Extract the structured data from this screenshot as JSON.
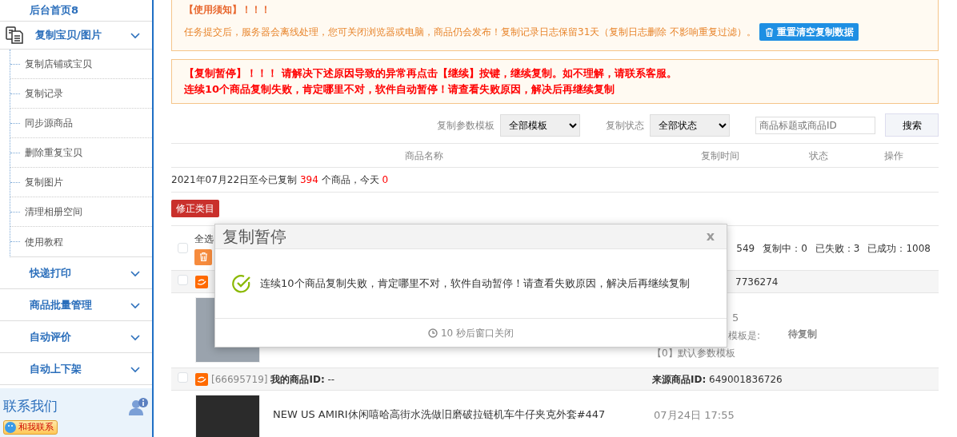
{
  "sidebar": {
    "items": [
      {
        "label": "后台首页8",
        "kind": "link"
      },
      {
        "label": "复制宝贝/图片",
        "kind": "group",
        "children": [
          {
            "label": "复制店铺或宝贝"
          },
          {
            "label": "复制记录"
          },
          {
            "label": "同步源商品"
          },
          {
            "label": "删除重复宝贝"
          },
          {
            "label": "复制图片"
          },
          {
            "label": "清理相册空间"
          },
          {
            "label": "使用教程"
          }
        ]
      },
      {
        "label": "快递打印",
        "kind": "group"
      },
      {
        "label": "商品批量管理",
        "kind": "group"
      },
      {
        "label": "自动评价",
        "kind": "group"
      },
      {
        "label": "自动上下架",
        "kind": "group"
      }
    ],
    "contact": {
      "title": "联系我们",
      "button": "和我联系"
    }
  },
  "notice": {
    "title": "【使用须知】！！！",
    "text": "任务提交后，服务器会离线处理，您可关闭浏览器或电脑，商品仍会发布！复制记录日志保留31天（复制日志删除 不影响重复过滤）。",
    "button": "重置清空复制数据"
  },
  "pause_notice": {
    "lines": [
      "【复制暂停】！！！ 请解决下述原因导致的异常再点击【继续】按键，继续复制。如不理解，请联系客服。",
      "连续10个商品复制失败，肯定哪里不对，软件自动暂停！请查看失败原因，解决后再继续复制"
    ]
  },
  "filters": [
    {
      "label": "复制参数模板",
      "value": "全部模板"
    },
    {
      "label": "复制状态",
      "value": "全部状态"
    }
  ],
  "search": {
    "placeholder": "商品标题或商品ID",
    "button": "搜索"
  },
  "columns": [
    "商品名称",
    "复制时间",
    "状态",
    "操作"
  ],
  "summary": {
    "prefix": "2021年07月22日至今已复制",
    "count": "394",
    "middle": "个商品，今天",
    "today": "0"
  },
  "fix_button": "修正类目",
  "select_all": {
    "label": "全选",
    "checked": false
  },
  "stats": [
    "549",
    "复制中：0",
    "已失败：3",
    "已成功：1008"
  ],
  "products": [
    {
      "checked": false,
      "source_id": "7736274",
      "time": "5",
      "template_label": "模板是:",
      "template": "【0】默认参数模板",
      "status": "待复制"
    },
    {
      "checked": false,
      "id": "[66695719]",
      "my_id_label": "我的商品ID:",
      "my_id": "--",
      "source_id_label": "来源商品ID:",
      "source_id": "649001836726",
      "title": "NEW US AMIRI休闲嘻哈高街水洗做旧磨破拉链机车牛仔夹克外套#447",
      "time": "07月24日 17:55"
    }
  ],
  "dialog": {
    "title": "复制暂停",
    "close": "x",
    "message": "连续10个商品复制失败，肯定哪里不对，软件自动暂停！请查看失败原因，解决后再继续复制",
    "footer": "10 秒后窗口关闭"
  }
}
